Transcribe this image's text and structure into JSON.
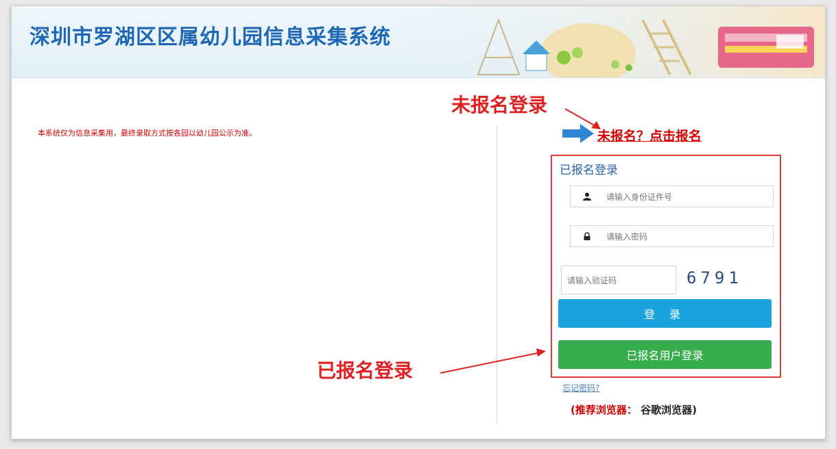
{
  "header": {
    "title": "深圳市罗湖区区属幼儿园信息采集系统"
  },
  "notice": "本系统仅为信息采集用，最终录取方式按各园以幼儿园公示为准。",
  "annotations": {
    "top": "未报名登录",
    "bottom": "已报名登录"
  },
  "register_link": "未报名？点击报名",
  "login": {
    "title": "已报名登录",
    "id_placeholder": "请输入身份证件号",
    "password_placeholder": "请输入密码",
    "captcha_placeholder": "请输入验证码",
    "captcha_code": "6791",
    "login_button": "登 录",
    "registered_button": "已报名用户登录",
    "forgot_link": "忘记密码?"
  },
  "recommend": {
    "label": "(推荐浏览器：",
    "browser": "谷歌浏览器)"
  },
  "colors": {
    "accent_blue": "#1d67b5",
    "login_button": "#1aa3de",
    "registered_button": "#36ad4d",
    "annotation_red": "#e02020"
  }
}
